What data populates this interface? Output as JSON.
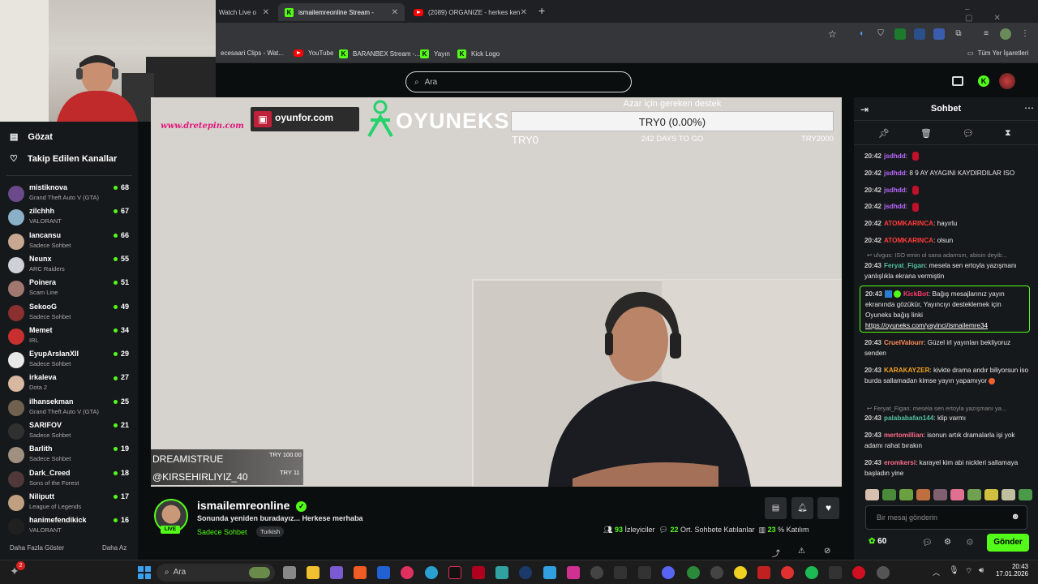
{
  "browser": {
    "tabs": [
      {
        "label": "Watch Live o"
      },
      {
        "label": "ismailemreonline Stream - "
      },
      {
        "label": "(2089) ORGANIZE - herkes ken"
      }
    ],
    "bookmarks": [
      "ecesaari Clips - Wat...",
      "YouTube",
      "BARANBEX Stream -...",
      "Yayın",
      "Kick Logo"
    ],
    "other_bookmarks": "Tüm Yer İşaretleri"
  },
  "header": {
    "search_placeholder": "Ara"
  },
  "sidebar": {
    "nav": [
      {
        "label": "Gözat"
      },
      {
        "label": "Takip Edilen Kanallar"
      }
    ],
    "channels": [
      {
        "name": "mistiknova",
        "category": "Grand Theft Auto V (GTA)",
        "viewers": "68",
        "color": "#6a4a8a"
      },
      {
        "name": "zilchhh",
        "category": "VALORANT",
        "viewers": "67",
        "color": "#8ab0c8"
      },
      {
        "name": "lancansu",
        "category": "Sadece Sohbet",
        "viewers": "66",
        "color": "#c8a890"
      },
      {
        "name": "Neunx",
        "category": "ARC Raiders",
        "viewers": "55",
        "color": "#d0d0d8"
      },
      {
        "name": "Poinera",
        "category": "Scam Line",
        "viewers": "51",
        "color": "#a07870"
      },
      {
        "name": "SekooG",
        "category": "Sadece Sohbet",
        "viewers": "49",
        "color": "#8a3030"
      },
      {
        "name": "Memet",
        "category": "IRL",
        "viewers": "34",
        "color": "#c83030"
      },
      {
        "name": "EyupArslanXII",
        "category": "Sadece Sohbet",
        "viewers": "29",
        "color": "#e8e8e8"
      },
      {
        "name": "irkaleva",
        "category": "Dota 2",
        "viewers": "27",
        "color": "#d8b8a0"
      },
      {
        "name": "ilhansekman",
        "category": "Grand Theft Auto V (GTA)",
        "viewers": "25",
        "color": "#706050"
      },
      {
        "name": "SARIFOV",
        "category": "Sadece Sohbet",
        "viewers": "21",
        "color": "#303030"
      },
      {
        "name": "Barlith",
        "category": "Sadece Sohbet",
        "viewers": "19",
        "color": "#a09080"
      },
      {
        "name": "Dark_Creed",
        "category": "Sons of the Forest",
        "viewers": "18",
        "color": "#503838"
      },
      {
        "name": "Niliputt",
        "category": "League of Legends",
        "viewers": "17",
        "color": "#c0a080"
      },
      {
        "name": "hanimefendikick",
        "category": "VALORANT",
        "viewers": "16",
        "color": "#202020"
      }
    ],
    "show_more": "Daha Fazla Göster",
    "show_less": "Daha Az"
  },
  "player": {
    "logo_site": "www.dretepin.com",
    "sponsor1": "oyunfor.com",
    "sponsor2": "OYUNEKS",
    "goal_title": "Azar için gereken destek",
    "goal_value": "TRY0 (0.00%)",
    "goal_min": "TRY0",
    "goal_days": "242 DAYS TO GO",
    "goal_max": "TRY2000",
    "goal_progress": 0,
    "donor1_name": "DREAMISTRUE",
    "donor1_amount": "TRY 100.00",
    "donor2_name": "@KIRSEHIRLIYIZ_40",
    "donor2_amount": "TRY 11"
  },
  "stream": {
    "channel": "ismailemreonline",
    "title": "Sonunda yeniden buradayız... Herkese merhaba",
    "category": "Sadece Sohbet",
    "tag": "Turkish",
    "live": "LIVE",
    "viewers": "93",
    "viewers_label": "İzleyiciler",
    "chatters": "22",
    "chatters_label": "Ort. Sohbete Katılanlar",
    "participation": "23",
    "participation_label": "% Katılım"
  },
  "chat": {
    "title": "Sohbet",
    "messages": [
      {
        "time": "20:42",
        "user": "jsdhdd",
        "color": "#b967ff",
        "text": ""
      },
      {
        "time": "20:42",
        "user": "jsdhdd",
        "color": "#b967ff",
        "text": "8 9 AY AYAGINI KAYDIRDILAR ISO"
      },
      {
        "time": "20:42",
        "user": "jsdhdd",
        "color": "#b967ff",
        "text": ""
      },
      {
        "time": "20:42",
        "user": "jsdhdd",
        "color": "#b967ff",
        "text": ""
      },
      {
        "time": "20:42",
        "user": "ATOMKARINCA",
        "color": "#ff3b3b",
        "text": "hayırlu"
      },
      {
        "time": "20:42",
        "user": "ATOMKARINCA",
        "color": "#ff3b3b",
        "text": "olsun"
      }
    ],
    "reply1": "ulvgus: ISO emin ol sana adamsın, abisin deyib...",
    "msg_feryat": {
      "time": "20:43",
      "user": "Feryat_Figan",
      "color": "#53c0a0",
      "text": "mesela sen ertoyla yazışmanı yanlışlıkla ekrana vermiştin"
    },
    "kickbot": {
      "time": "20:43",
      "user": "KickBot",
      "color": "#ff3b6b",
      "text": "Bağış mesajlarınız yayın ekranında gözükür, Yayıncıyı desteklemek için Oyuneks bağış linki",
      "link": "https://oyuneks.com/yayinci/ismailemre34"
    },
    "msg_cruel": {
      "time": "20:43",
      "user": "CruelValourr",
      "color": "#ff8c5a",
      "text": "Güzel irl yayınları bekliyoruz senden"
    },
    "msg_kara": {
      "time": "20:43",
      "user": "KARAKAYZER",
      "color": "#f0a020",
      "text": "kivkte drama andır biliyorsun iso burda sallamadan kimse yayın yapamıyor"
    },
    "reply2": "Feryat_Figan: mesela sen ertoyla yazışmanı ya...",
    "msg_pala": {
      "time": "20:43",
      "user": "palababafan144",
      "color": "#53c0a0",
      "text": "klip varmı"
    },
    "msg_merto": {
      "time": "20:43",
      "user": "mertomillian",
      "color": "#ff6b8a",
      "text": "isonun artık dramalarla işi yok adamı rahat bırakın"
    },
    "msg_erom": {
      "time": "20:43",
      "user": "eromkersi",
      "color": "#ff6b8a",
      "text": "karayel kim abi nickleri sallamaya başladın yine"
    },
    "input_placeholder": "Bir mesaj gönderin",
    "points": "60",
    "send": "Gönder"
  },
  "taskbar": {
    "search": "Ara",
    "time": "20:43",
    "date": "17.01.2026",
    "badge": "2"
  }
}
